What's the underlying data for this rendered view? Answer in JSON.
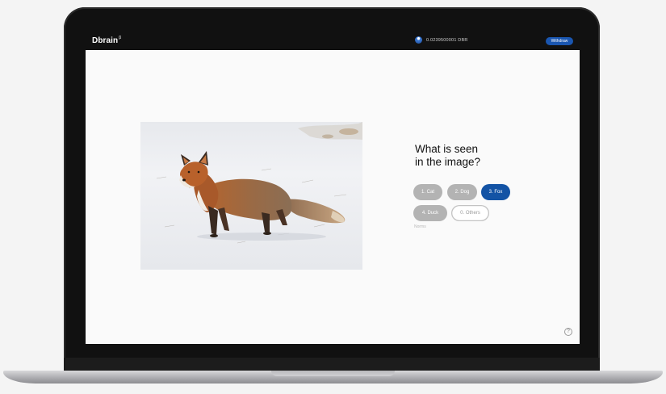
{
  "header": {
    "logo": "Dbrain",
    "logo_sup": "β",
    "balance": "0.0239500001 DBR",
    "withdraw_label": "Withdraw",
    "wallet_icon": "coin-icon"
  },
  "task": {
    "image_subject": "fox-in-snow",
    "question_line1": "What is seen",
    "question_line2": "in the image?",
    "options": [
      {
        "label": "1. Cat",
        "selected": false
      },
      {
        "label": "2. Dog",
        "selected": false
      },
      {
        "label": "3. Fox",
        "selected": true
      },
      {
        "label": "4. Duck",
        "selected": false
      },
      {
        "label": "0. Others",
        "selected": false
      }
    ],
    "hint": "Norms"
  },
  "footer": {
    "help_glyph": "?"
  },
  "colors": {
    "accent": "#1353a5",
    "withdraw": "#1a56b0",
    "option_default": "#b3b3b3",
    "bezel": "#111111"
  }
}
